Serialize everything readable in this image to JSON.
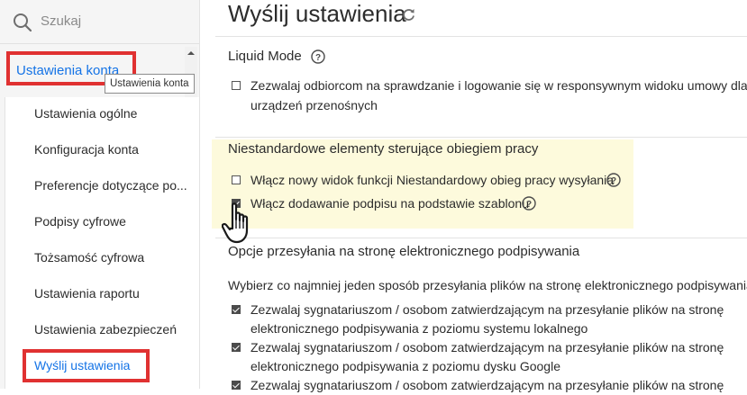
{
  "search": {
    "label": "Szukaj"
  },
  "sidebar": {
    "account_link": "Ustawienia konta",
    "tooltip": "Ustawienia konta",
    "items": [
      {
        "label": "Ustawienia ogólne"
      },
      {
        "label": "Konfiguracja konta"
      },
      {
        "label": "Preferencje dotyczące po..."
      },
      {
        "label": "Podpisy cyfrowe"
      },
      {
        "label": "Tożsamość cyfrowa"
      },
      {
        "label": "Ustawienia raportu"
      },
      {
        "label": "Ustawienia zabezpieczeń"
      },
      {
        "label": "Wyślij ustawienia",
        "active": true
      }
    ]
  },
  "main": {
    "title": "Wyślij ustawienia",
    "liquid_mode": {
      "heading": "Liquid Mode",
      "option_line1": "Zezwalaj odbiorcom na sprawdzanie i logowanie się w responsywnym widoku umowy dla",
      "option_line2": "urządzeń przenośnych",
      "option_checked": false
    },
    "custom_workflow": {
      "heading": "Niestandardowe elementy sterujące obiegiem pracy",
      "option1": "Włącz nowy widok funkcji Niestandardowy obieg pracy wysyłania",
      "option1_checked": false,
      "option2": "Włącz dodawanie podpisu na podstawie szablonu",
      "option2_checked": true
    },
    "upload": {
      "heading": "Opcje przesyłania na stronę elektronicznego podpisywania",
      "description": "Wybierz co najmniej jeden sposób przesyłania plików na stronę elektronicznego podpisywania",
      "options": [
        {
          "line1": "Zezwalaj sygnatariuszom / osobom zatwierdzającym na przesyłanie plików na stronę",
          "line2": "elektronicznego podpisywania z poziomu systemu lokalnego",
          "checked": true
        },
        {
          "line1": "Zezwalaj sygnatariuszom / osobom zatwierdzającym na przesyłanie plików na stronę",
          "line2": "elektronicznego podpisywania z poziomu dysku Google",
          "checked": true
        },
        {
          "line1": "Zezwalaj sygnatariuszom / osobom zatwierdzającym na przesyłanie plików na stronę",
          "checked": true
        }
      ]
    }
  },
  "colors": {
    "accent": "#1473e6",
    "annotation_red": "#e03131",
    "highlight": "#fdfadc"
  }
}
